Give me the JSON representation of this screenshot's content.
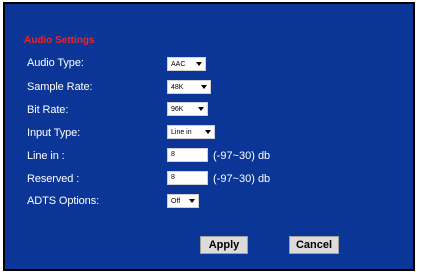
{
  "title": "Audio Settings",
  "fields": [
    {
      "label": "Audio Type:",
      "kind": "select",
      "value": "AAC"
    },
    {
      "label": "Sample Rate:",
      "kind": "select",
      "value": "48K"
    },
    {
      "label": "Bit Rate:",
      "kind": "select",
      "value": "96K"
    },
    {
      "label": "Input Type:",
      "kind": "select",
      "value": "Line in"
    },
    {
      "label": "Line in :",
      "kind": "input",
      "value": "8",
      "range": "(-97~30) db"
    },
    {
      "label": "Reserved :",
      "kind": "input",
      "value": "8",
      "range": "(-97~30) db"
    },
    {
      "label": "ADTS Options:",
      "kind": "select",
      "value": "Off"
    }
  ],
  "buttons": {
    "apply": "Apply",
    "cancel": "Cancel"
  },
  "colors": {
    "panel_bg": "#0b3596",
    "title": "#e4292b",
    "label": "#ffffff"
  }
}
